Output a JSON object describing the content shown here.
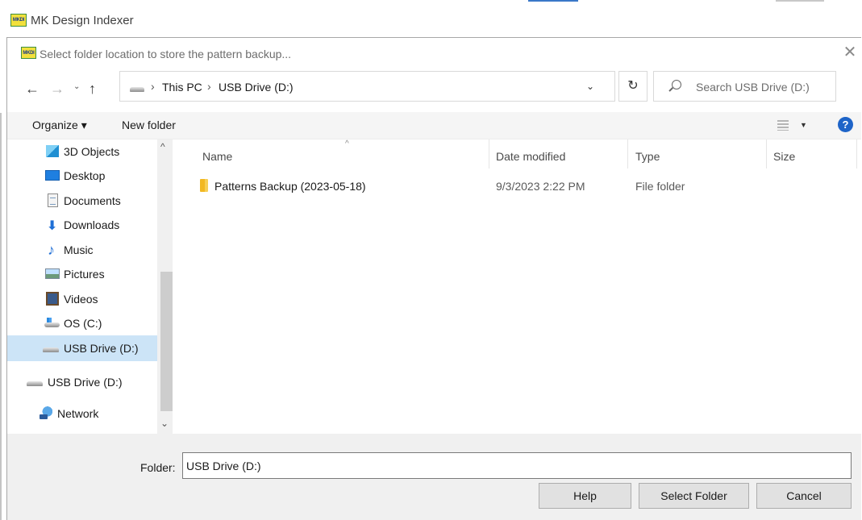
{
  "app": {
    "title": "MK Design Indexer",
    "logo_text": "MKDI"
  },
  "dialog": {
    "title": "Select folder location to store the pattern backup...",
    "logo_text": "MKDI",
    "close_glyph": "✕"
  },
  "navbar": {
    "back_glyph": "←",
    "forward_glyph": "→",
    "recent_glyph": "⌄",
    "up_glyph": "↑",
    "breadcrumbs": [
      "This PC",
      "USB Drive (D:)"
    ],
    "separator": "›",
    "dropdown_glyph": "⌄",
    "refresh_glyph": "↻",
    "search_placeholder": "Search USB Drive (D:)"
  },
  "toolbar": {
    "organize_label": "Organize ▾",
    "new_folder_label": "New folder",
    "view_dropdown_glyph": "▼",
    "help_glyph": "?"
  },
  "navpane": {
    "items": [
      {
        "label": "3D Objects",
        "icon": "3d-objects-icon"
      },
      {
        "label": "Desktop",
        "icon": "desktop-icon"
      },
      {
        "label": "Documents",
        "icon": "documents-icon"
      },
      {
        "label": "Downloads",
        "icon": "downloads-icon"
      },
      {
        "label": "Music",
        "icon": "music-icon"
      },
      {
        "label": "Pictures",
        "icon": "pictures-icon"
      },
      {
        "label": "Videos",
        "icon": "videos-icon"
      },
      {
        "label": "OS (C:)",
        "icon": "os-drive-icon"
      },
      {
        "label": "USB Drive (D:)",
        "icon": "usb-drive-icon",
        "selected": true
      },
      {
        "label": "USB Drive (D:)",
        "icon": "usb-drive-icon"
      },
      {
        "label": "Network",
        "icon": "network-icon"
      }
    ],
    "scroll_up_glyph": "^",
    "scroll_down_glyph": "⌄",
    "selected_color": "#cce4f7"
  },
  "content": {
    "sort_glyph": "^",
    "columns": [
      "Name",
      "Date modified",
      "Type",
      "Size"
    ],
    "rows": [
      {
        "name": "Patterns Backup (2023-05-18)",
        "date_modified": "9/3/2023 2:22 PM",
        "type": "File folder",
        "size": ""
      }
    ]
  },
  "bottom": {
    "folder_label": "Folder:",
    "folder_value": "USB Drive (D:)",
    "help_button": "Help",
    "select_button": "Select Folder",
    "cancel_button": "Cancel"
  },
  "colors": {
    "accent": "#1e64c8",
    "selection": "#cce4f7",
    "folder": "#f2b822"
  }
}
